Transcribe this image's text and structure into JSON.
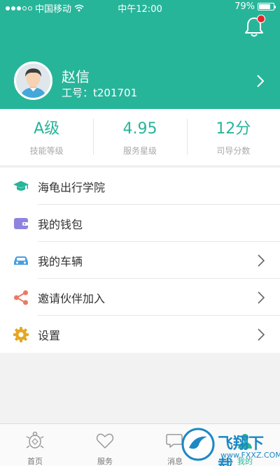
{
  "status_bar": {
    "carrier": "中国移动",
    "time": "中午12:00",
    "battery": "79%",
    "battery_level": 0.79
  },
  "header": {
    "notification_icon": "bell-icon",
    "notification_badge_color": "#e3262e",
    "accent_color": "#27b59a"
  },
  "profile": {
    "name": "赵信",
    "job_number": "工号：t201701",
    "arrow_icon": "chevron-right-icon"
  },
  "stats": [
    {
      "value": "A级",
      "label": "技能等级"
    },
    {
      "value": "4.95",
      "label": "服务星级"
    },
    {
      "value": "12分",
      "label": "司导分数"
    }
  ],
  "menu": [
    {
      "label": "海龟出行学院",
      "icon": "graduation-cap-icon",
      "has_arrow": false
    },
    {
      "label": "我的钱包",
      "icon": "wallet-icon",
      "has_arrow": false
    },
    {
      "label": "我的车辆",
      "icon": "car-icon",
      "has_arrow": true
    },
    {
      "label": "邀请伙伴加入",
      "icon": "share-icon",
      "has_arrow": true
    },
    {
      "label": "设置",
      "icon": "gear-icon",
      "has_arrow": true
    }
  ],
  "tabs": [
    {
      "label": "首页",
      "icon": "turtle-icon"
    },
    {
      "label": "服务",
      "icon": "heart-icon"
    },
    {
      "label": "消息",
      "icon": "chat-icon"
    },
    {
      "label": "我的",
      "icon": "profile-icon",
      "active": true
    }
  ],
  "watermark": {
    "text": "飞翔下载",
    "url": "www.FXXZ.COM"
  }
}
